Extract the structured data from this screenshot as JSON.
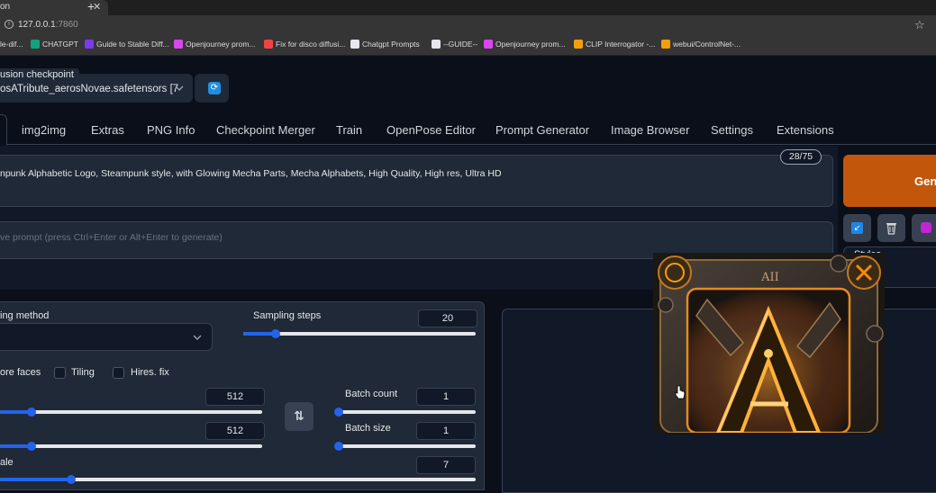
{
  "browser": {
    "tab_title": "on",
    "tab_close": "✕",
    "new_tab": "+",
    "address_host": "127.0.0.1",
    "address_port": ":7860",
    "bookmarks": [
      {
        "label": "le-dif...",
        "icon": "favicon-icon",
        "color": "#6b7280"
      },
      {
        "label": "CHATGPT",
        "icon": "chatgpt-icon",
        "color": "#10a37f"
      },
      {
        "label": "Guide to Stable Diff...",
        "icon": "stability-icon",
        "color": "#7c3aed"
      },
      {
        "label": "Openjourney prom...",
        "icon": "openjourney-icon",
        "color": "#d946ef"
      },
      {
        "label": "Fix for disco diffusi...",
        "icon": "youtube-icon",
        "color": "#ef4444"
      },
      {
        "label": "Chatgpt Prompts",
        "icon": "github-icon",
        "color": "#e5e7eb"
      },
      {
        "label": "--GUIDE--",
        "icon": "reddit-r-icon",
        "color": "#e5e7eb"
      },
      {
        "label": "Openjourney prom...",
        "icon": "openjourney-icon",
        "color": "#d946ef"
      },
      {
        "label": "CLIP Interrogator -...",
        "icon": "huggingface-icon",
        "color": "#f59e0b"
      },
      {
        "label": "webui/ControlNet-...",
        "icon": "huggingface-icon",
        "color": "#f59e0b"
      }
    ]
  },
  "checkpoint": {
    "label": "usion checkpoint",
    "value": "osATribute_aerosNovae.safetensors [7"
  },
  "tabs": [
    "img2img",
    "Extras",
    "PNG Info",
    "Checkpoint Merger",
    "Train",
    "OpenPose Editor",
    "Prompt Generator",
    "Image Browser",
    "Settings",
    "Extensions"
  ],
  "prompt": {
    "text": "npunk Alphabetic Logo, Steampunk style, with Glowing Mecha Parts, Mecha Alphabets, High Quality, High res, Ultra HD",
    "token_count": "28/75",
    "negative_placeholder": "ve prompt (press Ctrl+Enter or Alt+Enter to generate)"
  },
  "generate": {
    "label": "Gene"
  },
  "tools": [
    "paste-icon",
    "trash-icon",
    "style-icon"
  ],
  "styles": {
    "label": "Styles"
  },
  "settings": {
    "sampling_method_label": "ing method",
    "sampling_steps_label": "Sampling steps",
    "sampling_steps_value": "20",
    "sampling_steps_fraction": 0.14,
    "restore_faces_label": "ore faces",
    "tiling_label": "Tiling",
    "hires_label": "Hires. fix",
    "width_value": "512",
    "width_fraction": 0.12,
    "height_value": "512",
    "height_fraction": 0.12,
    "batch_count_label": "Batch count",
    "batch_count_value": "1",
    "batch_count_fraction": 0.0,
    "batch_size_label": "Batch size",
    "batch_size_value": "1",
    "batch_size_fraction": 0.0,
    "cfg_label": "ale",
    "cfg_value": "7",
    "cfg_fraction": 0.15,
    "swap_icon": "⇅"
  },
  "output_image": {
    "text": "AII"
  },
  "colors": {
    "accent": "#2563eb",
    "generate": "#c2570c",
    "background": "#0b0f19",
    "panel": "#1f2937"
  }
}
